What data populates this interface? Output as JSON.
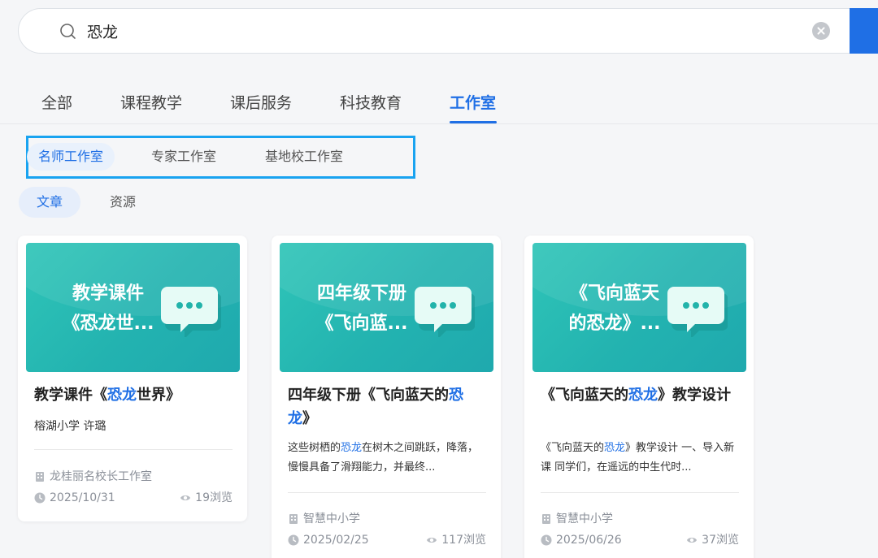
{
  "search": {
    "query": "恐龙"
  },
  "colors": {
    "accent": "#1f6fe5",
    "highlight_box": "#19a3f0",
    "thumb_teal": "#2fc5b8"
  },
  "main_tabs": [
    {
      "label": "全部"
    },
    {
      "label": "课程教学"
    },
    {
      "label": "课后服务"
    },
    {
      "label": "科技教育"
    },
    {
      "label": "工作室",
      "active": true
    }
  ],
  "sub_tabs": [
    {
      "label": "名师工作室",
      "active": true
    },
    {
      "label": "专家工作室"
    },
    {
      "label": "基地校工作室"
    }
  ],
  "type_tabs": [
    {
      "label": "文章",
      "active": true
    },
    {
      "label": "资源"
    }
  ],
  "cards": [
    {
      "thumb_line1": "教学课件",
      "thumb_line2": "《恐龙世...",
      "title_pre": "教学课件《",
      "title_hl": "恐龙",
      "title_post": "世界》",
      "author": "榕湖小学 许璐",
      "studio": "龙桂丽名校长工作室",
      "date": "2025/10/31",
      "views": "19浏览"
    },
    {
      "thumb_line1": "四年级下册",
      "thumb_line2": "《飞向蓝...",
      "title_pre": "四年级下册《飞向蓝天的",
      "title_hl": "恐",
      "title_hl2": "龙",
      "title_post": "》",
      "desc_pre": "这些树栖的",
      "desc_hl": "恐龙",
      "desc_post": "在树木之间跳跃，降落，慢慢具备了滑翔能力，并最终...",
      "studio": "智慧中小学",
      "date": "2025/02/25",
      "views": "117浏览"
    },
    {
      "thumb_line1": "《飞向蓝天",
      "thumb_line2": "的恐龙》...",
      "title_pre": "《飞向蓝天的",
      "title_hl": "恐龙",
      "title_post": "》教学设计",
      "desc_pre": "《飞向蓝天的",
      "desc_hl": "恐龙",
      "desc_post": "》教学设计 一、导入新课 同学们，在遥远的中生代时...",
      "studio": "智慧中小学",
      "date": "2025/06/26",
      "views": "37浏览"
    }
  ]
}
